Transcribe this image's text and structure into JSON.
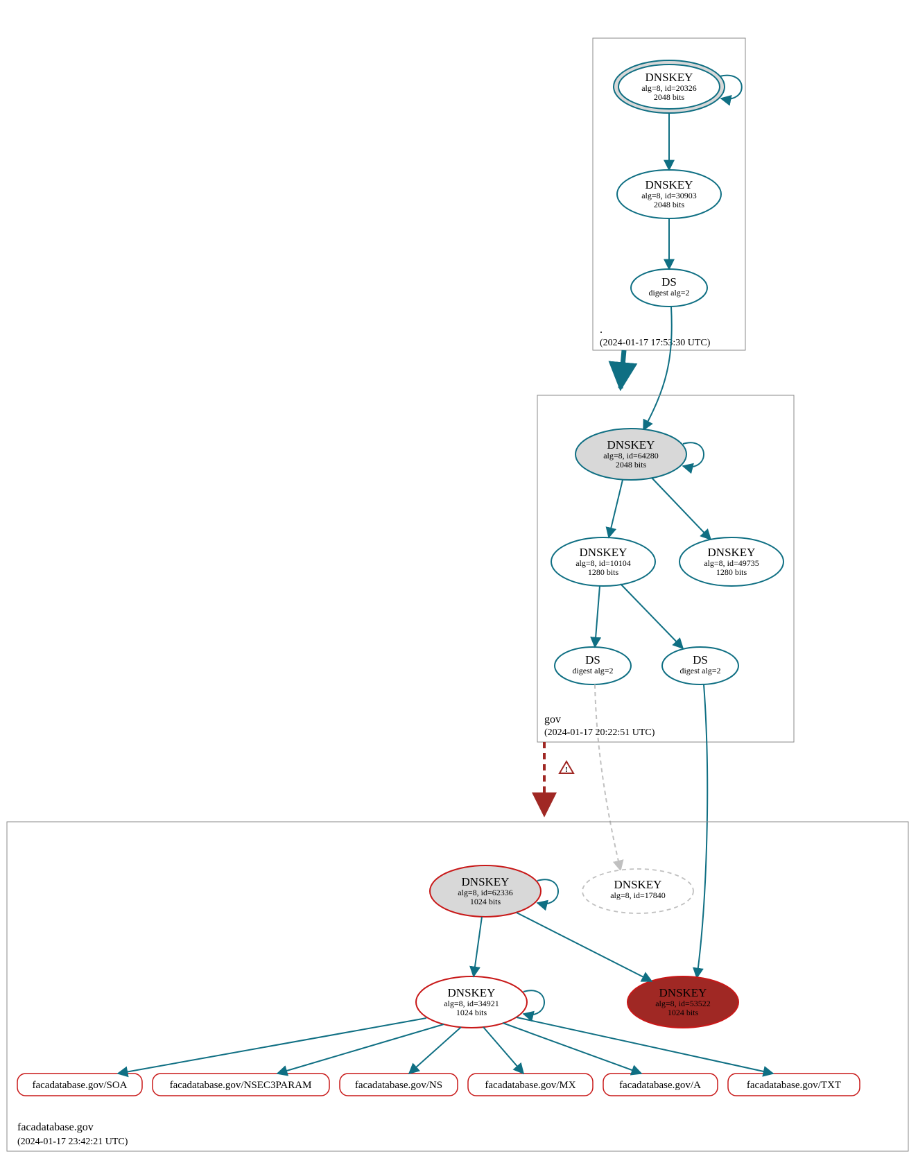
{
  "colors": {
    "teal": "#0f6f83",
    "red": "#c81818",
    "red_dark": "#a02824",
    "grey_light": "#c0c0c0",
    "ksk_fill": "#d8d8d8"
  },
  "zones": {
    "root": {
      "label": ".",
      "timestamp": "(2024-01-17 17:53:30 UTC)"
    },
    "gov": {
      "label": "gov",
      "timestamp": "(2024-01-17 20:22:51 UTC)"
    },
    "domain": {
      "label": "facadatabase.gov",
      "timestamp": "(2024-01-17 23:42:21 UTC)"
    }
  },
  "nodes": {
    "root_ksk": {
      "title": "DNSKEY",
      "l2": "alg=8, id=20326",
      "l3": "2048 bits"
    },
    "root_zsk": {
      "title": "DNSKEY",
      "l2": "alg=8, id=30903",
      "l3": "2048 bits"
    },
    "root_ds": {
      "title": "DS",
      "l2": "digest alg=2"
    },
    "gov_ksk": {
      "title": "DNSKEY",
      "l2": "alg=8, id=64280",
      "l3": "2048 bits"
    },
    "gov_zsk1": {
      "title": "DNSKEY",
      "l2": "alg=8, id=10104",
      "l3": "1280 bits"
    },
    "gov_zsk2": {
      "title": "DNSKEY",
      "l2": "alg=8, id=49735",
      "l3": "1280 bits"
    },
    "gov_ds1": {
      "title": "DS",
      "l2": "digest alg=2"
    },
    "gov_ds2": {
      "title": "DS",
      "l2": "digest alg=2"
    },
    "dom_ksk": {
      "title": "DNSKEY",
      "l2": "alg=8, id=62336",
      "l3": "1024 bits"
    },
    "dom_missing": {
      "title": "DNSKEY",
      "l2": "alg=8, id=17840"
    },
    "dom_zsk": {
      "title": "DNSKEY",
      "l2": "alg=8, id=34921",
      "l3": "1024 bits"
    },
    "dom_extra": {
      "title": "DNSKEY",
      "l2": "alg=8, id=53522",
      "l3": "1024 bits"
    }
  },
  "rrsets": {
    "r1": "facadatabase.gov/SOA",
    "r2": "facadatabase.gov/NSEC3PARAM",
    "r3": "facadatabase.gov/NS",
    "r4": "facadatabase.gov/MX",
    "r5": "facadatabase.gov/A",
    "r6": "facadatabase.gov/TXT"
  },
  "warning_icon": "⚠"
}
